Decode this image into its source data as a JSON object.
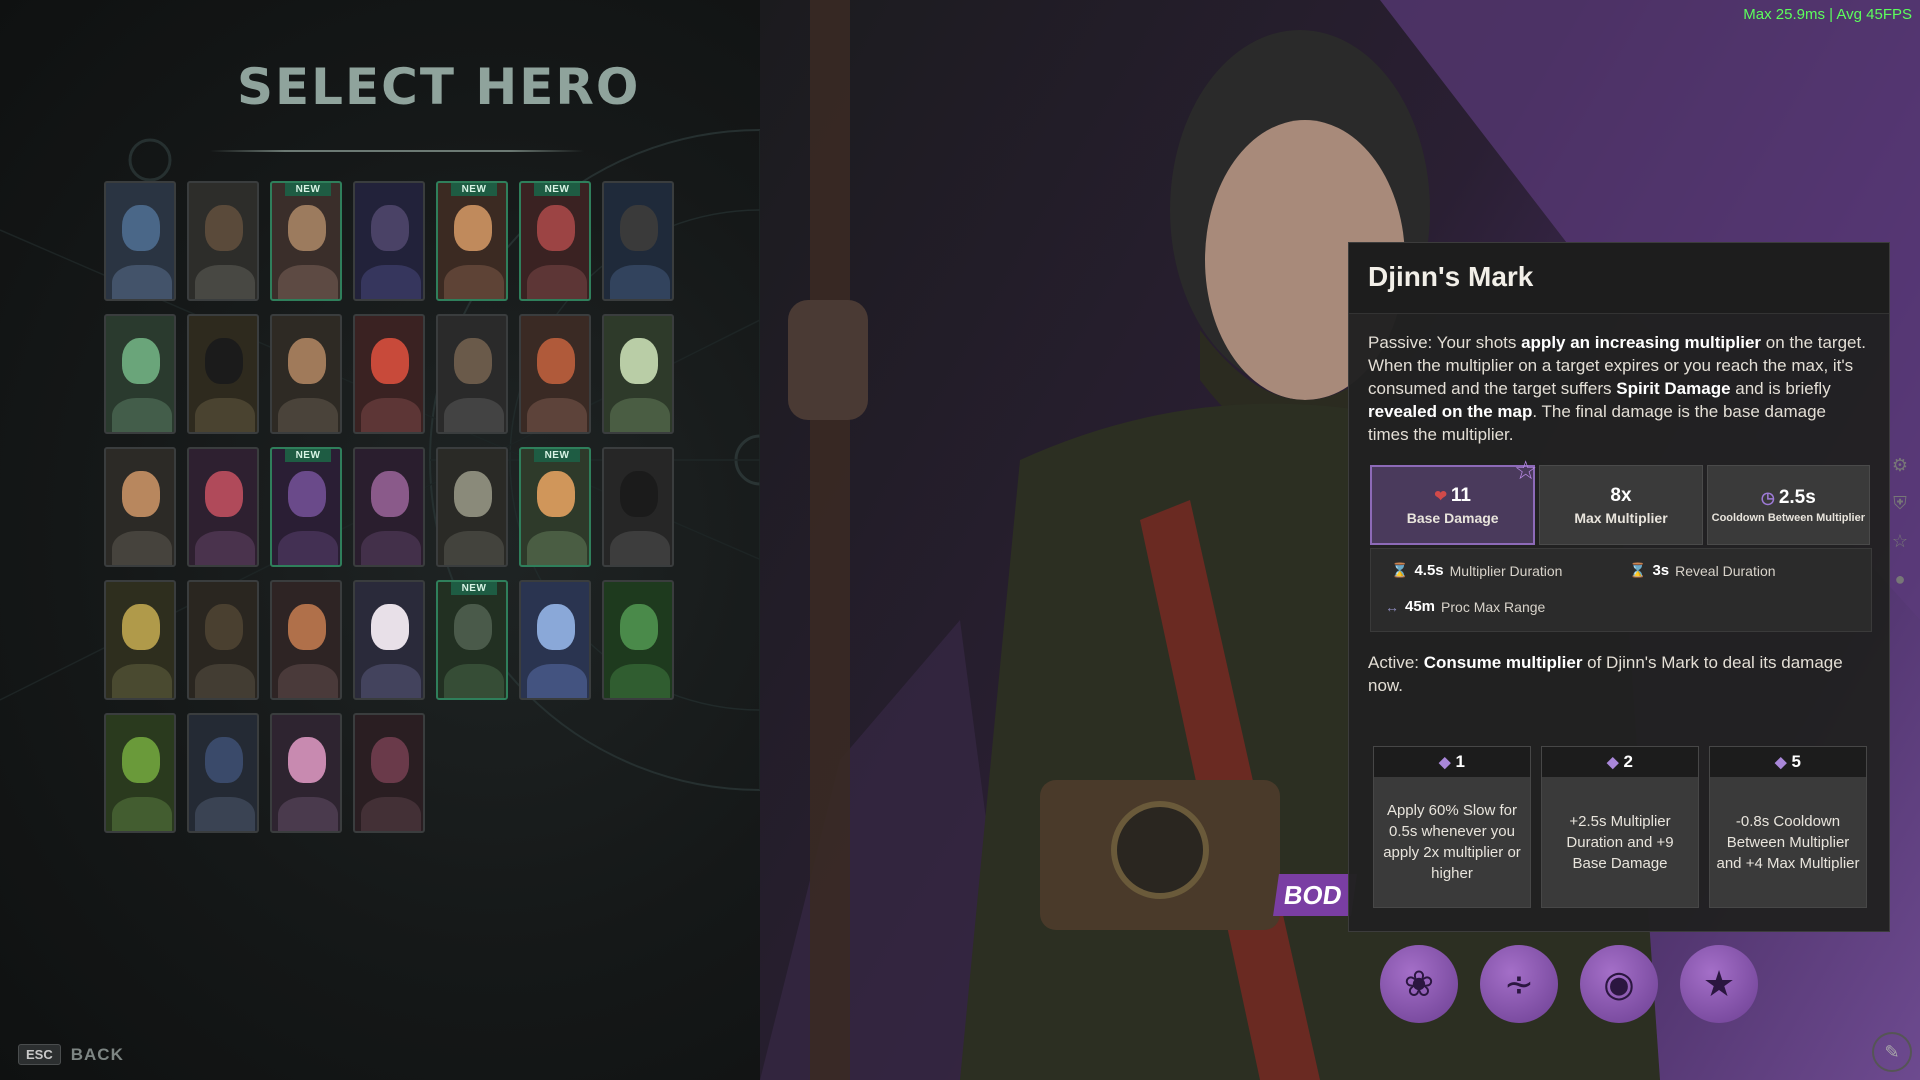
{
  "overlay": {
    "fps_text": "Max  25.9ms | Avg   45FPS"
  },
  "hero_select": {
    "title": "SELECT HERO",
    "new_label": "NEW",
    "back_key": "ESC",
    "back_label": "BACK",
    "heroes": [
      {
        "new": false,
        "skin": "#4a6788",
        "bg": "#2a3442"
      },
      {
        "new": false,
        "skin": "#5a4a3a",
        "bg": "#2d2d2a"
      },
      {
        "new": true,
        "skin": "#9c7b5e",
        "bg": "#3a2e2a"
      },
      {
        "new": false,
        "skin": "#4a4266",
        "bg": "#22223a"
      },
      {
        "new": true,
        "skin": "#c08a5c",
        "bg": "#3b2a22"
      },
      {
        "new": true,
        "skin": "#9c4444",
        "bg": "#3a2222"
      },
      {
        "new": false,
        "skin": "#3a3a3a",
        "bg": "#1f2a3a"
      },
      {
        "new": false,
        "skin": "#6aa57a",
        "bg": "#2a3a2e"
      },
      {
        "new": false,
        "skin": "#1b1b1b",
        "bg": "#2e2a1e"
      },
      {
        "new": false,
        "skin": "#a07a5a",
        "bg": "#2e2a24"
      },
      {
        "new": false,
        "skin": "#c84a3a",
        "bg": "#3a2222"
      },
      {
        "new": false,
        "skin": "#6a5a4a",
        "bg": "#2a2a2a"
      },
      {
        "new": false,
        "skin": "#b05a3a",
        "bg": "#3a2a24"
      },
      {
        "new": false,
        "skin": "#b9cda6",
        "bg": "#2e3a2a"
      },
      {
        "new": false,
        "skin": "#b8875e",
        "bg": "#2c2a26"
      },
      {
        "new": false,
        "skin": "#b04a5a",
        "bg": "#2e2030"
      },
      {
        "new": true,
        "skin": "#6a4a8a",
        "bg": "#2a1e34"
      },
      {
        "new": false,
        "skin": "#8a5a8a",
        "bg": "#2a1e2e"
      },
      {
        "new": false,
        "skin": "#8a8a7a",
        "bg": "#2a2a26"
      },
      {
        "new": true,
        "skin": "#d0965a",
        "bg": "#2e3a2a"
      },
      {
        "new": false,
        "skin": "#1b1b1b",
        "bg": "#262626"
      },
      {
        "new": false,
        "skin": "#b09a4a",
        "bg": "#2e2e1e"
      },
      {
        "new": false,
        "skin": "#4a4030",
        "bg": "#2a2620"
      },
      {
        "new": false,
        "skin": "#b0704a",
        "bg": "#2e2424"
      },
      {
        "new": false,
        "skin": "#e8e0e8",
        "bg": "#2a2a3a"
      },
      {
        "new": true,
        "skin": "#4a5a4a",
        "bg": "#223022"
      },
      {
        "new": false,
        "skin": "#8aa8d8",
        "bg": "#2a3450"
      },
      {
        "new": false,
        "skin": "#4a8a4a",
        "bg": "#1e3a1e"
      },
      {
        "new": false,
        "skin": "#6a9a3a",
        "bg": "#2a3a1e"
      },
      {
        "new": false,
        "skin": "#3a4a6a",
        "bg": "#242a34"
      },
      {
        "new": false,
        "skin": "#c88ab0",
        "bg": "#2e2430"
      },
      {
        "new": false,
        "skin": "#6a3a4a",
        "bg": "#2a1e22"
      }
    ]
  },
  "ability": {
    "name": "Djinn's Mark",
    "passive_parts": [
      {
        "t": "Passive:  Your shots ",
        "b": false
      },
      {
        "t": "apply an increasing multiplier",
        "b": true
      },
      {
        "t": " on the target. When the multiplier on a target expires or you reach the max, it's consumed and the target suffers ",
        "b": false
      },
      {
        "t": "Spirit Damage",
        "b": true
      },
      {
        "t": " and is briefly ",
        "b": false
      },
      {
        "t": "revealed on the map",
        "b": true
      },
      {
        "t": ". The final damage is the base damage times the multiplier.",
        "b": false
      }
    ],
    "stats": [
      {
        "value": "11",
        "label": "Base Damage",
        "icon": "heart-icon"
      },
      {
        "value": "8x",
        "label": "Max Multiplier",
        "icon": ""
      },
      {
        "value": "2.5s",
        "label": "Cooldown Between Multiplier",
        "icon": "clock-icon"
      }
    ],
    "details": [
      {
        "value": "4.5s",
        "label": "Multiplier Duration"
      },
      {
        "value": "3s",
        "label": "Reveal Duration"
      },
      {
        "value": "45m",
        "label": "Proc Max Range"
      }
    ],
    "active_parts": [
      {
        "t": "Active:  ",
        "b": false
      },
      {
        "t": "Consume multiplier",
        "b": true
      },
      {
        "t": " of Djinn's Mark to deal its damage now.",
        "b": false
      }
    ],
    "upgrades": [
      {
        "cost": "1",
        "text": "Apply 60% Slow for 0.5s whenever you apply 2x multiplier or higher"
      },
      {
        "cost": "2",
        "text": "+2.5s Multiplier Duration and +9 Base Damage"
      },
      {
        "cost": "5",
        "text": "-0.8s Cooldown Between Multiplier and +4 Max Multiplier"
      }
    ]
  },
  "bod_tag": "BOD",
  "ability_icons": [
    "beetle-icon",
    "tornado-icon",
    "eye-icon",
    "spirit-icon"
  ],
  "colors": {
    "accent_purple": "#8d6ab8",
    "new_green": "#2f7f5b",
    "fps_green": "#5cff5c"
  }
}
